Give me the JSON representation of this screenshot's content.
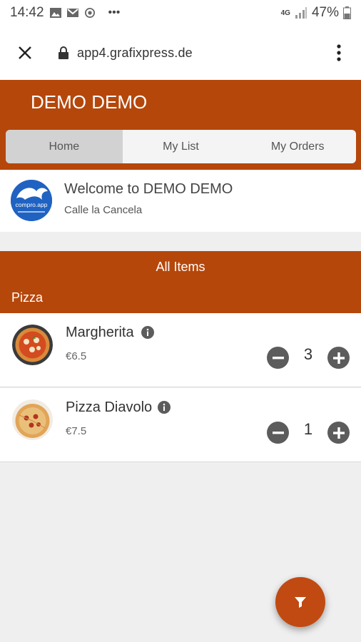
{
  "status_bar": {
    "time": "14:42",
    "network": "4G",
    "battery": "47%"
  },
  "browser": {
    "url": "app4.grafixpress.de"
  },
  "app": {
    "shop_name": "DEMO DEMO",
    "tabs": [
      {
        "label": "Home",
        "active": true
      },
      {
        "label": "My List",
        "active": false
      },
      {
        "label": "My Orders",
        "active": false
      }
    ],
    "brand_color": "#b5470b"
  },
  "welcome": {
    "title": "Welcome to DEMO DEMO",
    "address": "Calle la Cancela",
    "logo_text": "compro.app"
  },
  "menu": {
    "section_title": "All Items",
    "category": "Pizza",
    "items": [
      {
        "name": "Margherita",
        "price": "€6.5",
        "quantity": "3"
      },
      {
        "name": "Pizza Diavolo",
        "price": "€7.5",
        "quantity": "1"
      }
    ]
  },
  "fab": {
    "icon": "filter-icon"
  }
}
